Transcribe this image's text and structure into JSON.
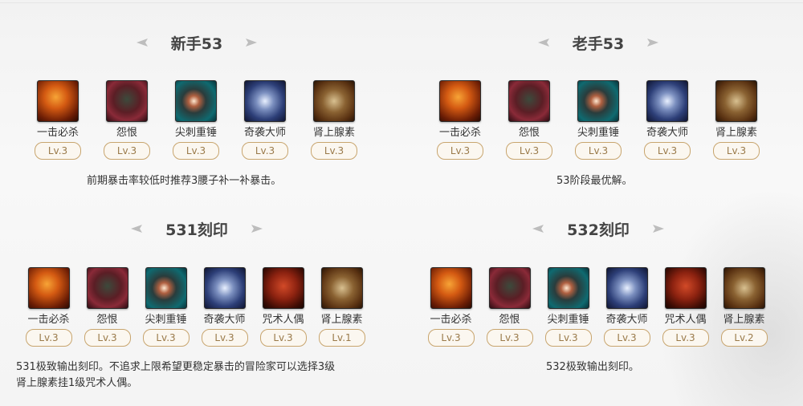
{
  "panels": [
    {
      "title": "新手53",
      "skills": [
        {
          "name": "一击必杀",
          "level": "Lv.3",
          "icon": "fire-strike-icon"
        },
        {
          "name": "怨恨",
          "level": "Lv.3",
          "icon": "grudge-beast-icon"
        },
        {
          "name": "尖刺重锤",
          "level": "Lv.3",
          "icon": "spiked-ball-icon"
        },
        {
          "name": "奇袭大师",
          "level": "Lv.3",
          "icon": "raid-swirl-icon"
        },
        {
          "name": "肾上腺素",
          "level": "Lv.3",
          "icon": "adrenaline-icon"
        }
      ],
      "description": "前期暴击率较低时推荐3腰子补一补暴击。"
    },
    {
      "title": "老手53",
      "skills": [
        {
          "name": "一击必杀",
          "level": "Lv.3",
          "icon": "fire-strike-icon"
        },
        {
          "name": "怨恨",
          "level": "Lv.3",
          "icon": "grudge-beast-icon"
        },
        {
          "name": "尖刺重锤",
          "level": "Lv.3",
          "icon": "spiked-ball-icon"
        },
        {
          "name": "奇袭大师",
          "level": "Lv.3",
          "icon": "raid-swirl-icon"
        },
        {
          "name": "肾上腺素",
          "level": "Lv.3",
          "icon": "adrenaline-icon"
        }
      ],
      "description": "53阶段最优解。"
    },
    {
      "title": "531刻印",
      "skills": [
        {
          "name": "一击必杀",
          "level": "Lv.3",
          "icon": "fire-strike-icon"
        },
        {
          "name": "怨恨",
          "level": "Lv.3",
          "icon": "grudge-beast-icon"
        },
        {
          "name": "尖刺重锤",
          "level": "Lv.3",
          "icon": "spiked-ball-icon"
        },
        {
          "name": "奇袭大师",
          "level": "Lv.3",
          "icon": "raid-swirl-icon"
        },
        {
          "name": "咒术人偶",
          "level": "Lv.3",
          "icon": "cursed-doll-icon"
        },
        {
          "name": "肾上腺素",
          "level": "Lv.1",
          "icon": "adrenaline-icon"
        }
      ],
      "description_lines": [
        "531极致输出刻印。不追求上限希望更稳定暴击的冒险家可以选择3级",
        "肾上腺素挂1级咒术人偶。"
      ]
    },
    {
      "title": "532刻印",
      "skills": [
        {
          "name": "一击必杀",
          "level": "Lv.3",
          "icon": "fire-strike-icon"
        },
        {
          "name": "怨恨",
          "level": "Lv.3",
          "icon": "grudge-beast-icon"
        },
        {
          "name": "尖刺重锤",
          "level": "Lv.3",
          "icon": "spiked-ball-icon"
        },
        {
          "name": "奇袭大师",
          "level": "Lv.3",
          "icon": "raid-swirl-icon"
        },
        {
          "name": "咒术人偶",
          "level": "Lv.3",
          "icon": "cursed-doll-icon"
        },
        {
          "name": "肾上腺素",
          "level": "Lv.2",
          "icon": "adrenaline-icon"
        }
      ],
      "description": "532极致输出刻印。"
    }
  ]
}
